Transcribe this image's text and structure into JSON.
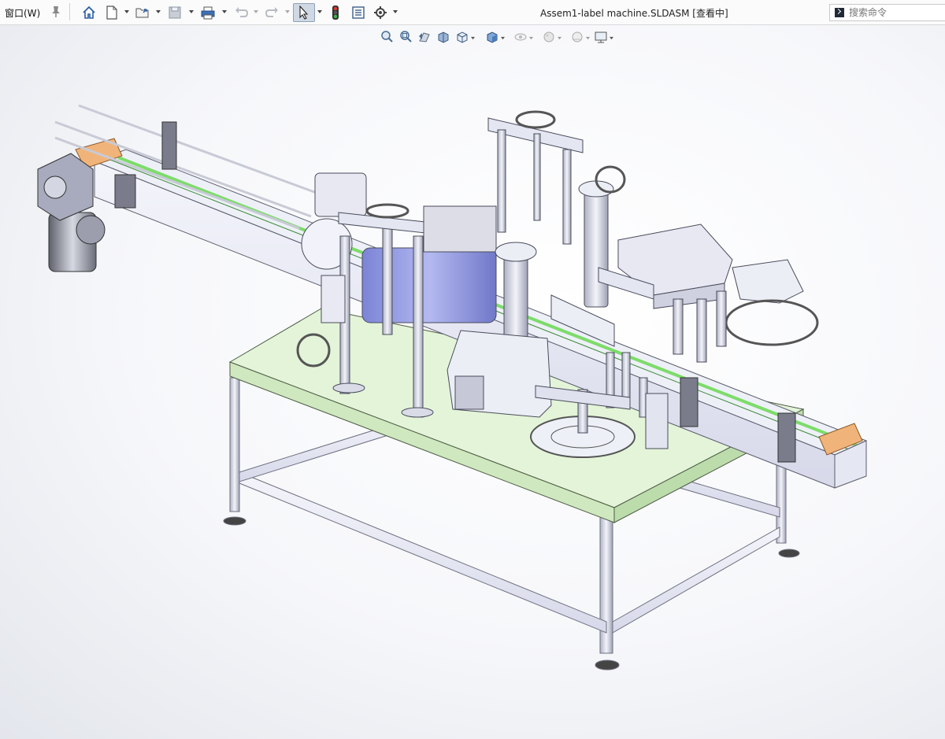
{
  "menu": {
    "window_label": "窗口(W)"
  },
  "toolbar": {
    "items": [
      "home-icon",
      "new-document-icon",
      "open-icon",
      "save-icon",
      "print-icon",
      "undo-icon",
      "redo-icon",
      "select-icon",
      "traffic-light-icon",
      "file-properties-icon",
      "options-icon"
    ]
  },
  "document": {
    "title": "Assem1-label machine.SLDASM [查看中]"
  },
  "search": {
    "placeholder": "搜索命令"
  },
  "heads_up_toolbar": {
    "items": [
      "zoom-to-fit-icon",
      "zoom-to-area-icon",
      "previous-view-icon",
      "section-view-icon",
      "view-orientation-icon",
      "display-style-icon",
      "hide-show-icon",
      "edit-appearance-icon",
      "apply-scene-icon",
      "view-settings-icon"
    ]
  },
  "colors": {
    "table_top": "#e3f4d8",
    "frame": "#e8e9f5",
    "label_drum": "#9aa2e6",
    "conveyor_belt": "#7ddc6a",
    "accent_orange": "#f0b47a"
  }
}
